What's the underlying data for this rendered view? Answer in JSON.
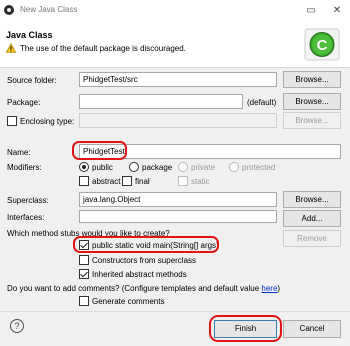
{
  "window": {
    "title": "New Java Class"
  },
  "header": {
    "title": "Java Class",
    "message": "The use of the default package is discouraged."
  },
  "form": {
    "source_folder": {
      "label": "Source folder:",
      "value": "PhidgetTest/src",
      "button": "Browse..."
    },
    "package": {
      "label": "Package:",
      "value": "",
      "default_text": "(default)",
      "button": "Browse..."
    },
    "enclosing_type": {
      "label": "Enclosing type:",
      "value": "",
      "button": "Browse..."
    },
    "name": {
      "label": "Name:",
      "value": "PhidgetTest"
    },
    "modifiers": {
      "label": "Modifiers:",
      "public": "public",
      "package": "package",
      "private": "private",
      "protected": "protected",
      "abstract": "abstract",
      "final": "final",
      "static": "static",
      "selected": "public"
    },
    "superclass": {
      "label": "Superclass:",
      "value": "java.lang.Object",
      "button": "Browse..."
    },
    "interfaces": {
      "label": "Interfaces:",
      "add_button": "Add...",
      "remove_button": "Remove"
    },
    "stubs": {
      "question": "Which method stubs would you like to create?",
      "main": "public static void main(String[] args)",
      "constructors": "Constructors from superclass",
      "inherited": "Inherited abstract methods"
    },
    "comments": {
      "question_prefix": "Do you want to add comments? (Configure templates and default value ",
      "link": "here",
      "question_suffix": ")",
      "generate": "Generate comments"
    }
  },
  "footer": {
    "help": "?",
    "finish": "Finish",
    "cancel": "Cancel"
  },
  "colors": {
    "highlight": "#e01515",
    "link": "#0033cc",
    "logo": "#3aa52a"
  },
  "icons": [
    "eclipse-icon",
    "minimize-icon",
    "close-icon",
    "warning-icon",
    "java-class-wizard-icon",
    "help-icon"
  ]
}
